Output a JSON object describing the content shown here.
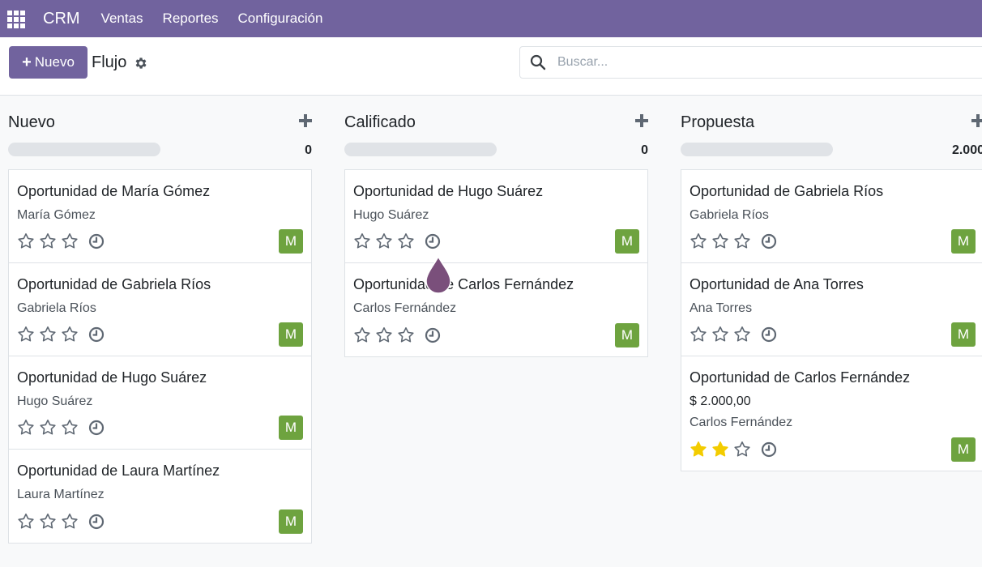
{
  "navbar": {
    "brand": "CRM",
    "menu": [
      "Ventas",
      "Reportes",
      "Configuración"
    ]
  },
  "control_panel": {
    "new_button_label": "Nuevo",
    "breadcrumb": "Flujo",
    "search_placeholder": "Buscar..."
  },
  "colors": {
    "brand": "#71639e",
    "avatar": "#6ea33f",
    "star_filled": "#f3cc00",
    "star_empty": "#5f6873"
  },
  "columns": [
    {
      "title": "Nuevo",
      "total": "0",
      "cards": [
        {
          "title": "Oportunidad de María Gómez",
          "contact": "María Gómez",
          "stars": 0,
          "avatar": "M"
        },
        {
          "title": "Oportunidad de Gabriela Ríos",
          "contact": "Gabriela Ríos",
          "stars": 0,
          "avatar": "M"
        },
        {
          "title": "Oportunidad de Hugo Suárez",
          "contact": "Hugo Suárez",
          "stars": 0,
          "avatar": "M"
        },
        {
          "title": "Oportunidad de Laura Martínez",
          "contact": "Laura Martínez",
          "stars": 0,
          "avatar": "M"
        }
      ]
    },
    {
      "title": "Calificado",
      "total": "0",
      "cards": [
        {
          "title": "Oportunidad de Hugo Suárez",
          "contact": "Hugo Suárez",
          "stars": 0,
          "avatar": "M"
        },
        {
          "title": "Oportunidad de Carlos Fernández",
          "contact": "Carlos Fernández",
          "stars": 0,
          "avatar": "M"
        }
      ]
    },
    {
      "title": "Propuesta",
      "total": "2.000",
      "cards": [
        {
          "title": "Oportunidad de Gabriela Ríos",
          "contact": "Gabriela Ríos",
          "stars": 0,
          "avatar": "M"
        },
        {
          "title": "Oportunidad de Ana Torres",
          "contact": "Ana Torres",
          "stars": 0,
          "avatar": "M"
        },
        {
          "title": "Oportunidad de Carlos Fernández",
          "amount": "$ 2.000,00",
          "contact": "Carlos Fernández",
          "stars": 2,
          "avatar": "M"
        }
      ]
    }
  ]
}
